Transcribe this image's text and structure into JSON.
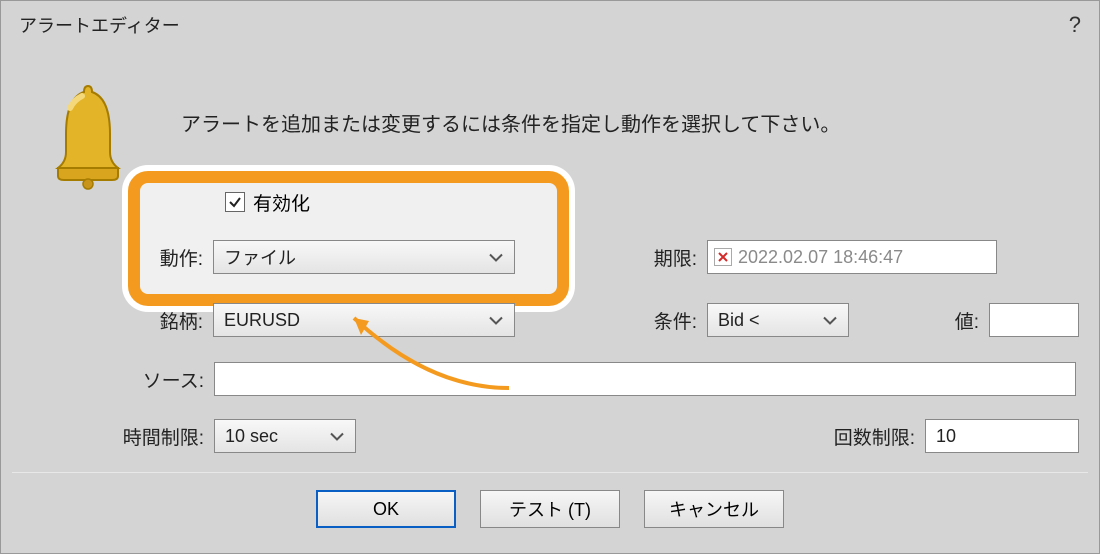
{
  "window": {
    "title": "アラートエディター"
  },
  "instruction": "アラートを追加または変更するには条件を指定し動作を選択して下さい。",
  "form": {
    "enable": {
      "label": "有効化",
      "checked": true
    },
    "action": {
      "label": "動作:",
      "value": "ファイル"
    },
    "expiry": {
      "label": "期限:",
      "value": "2022.02.07 18:46:47"
    },
    "symbol": {
      "label": "銘柄:",
      "value": "EURUSD"
    },
    "condition": {
      "label": "条件:",
      "value": "Bid <"
    },
    "value": {
      "label": "値:",
      "value": ""
    },
    "source": {
      "label": "ソース:",
      "value": ""
    },
    "timeout": {
      "label": "時間制限:",
      "value": "10 sec"
    },
    "iterations": {
      "label": "回数制限:",
      "value": "10"
    }
  },
  "buttons": {
    "ok": "OK",
    "test": "テスト (T)",
    "cancel": "キャンセル"
  }
}
